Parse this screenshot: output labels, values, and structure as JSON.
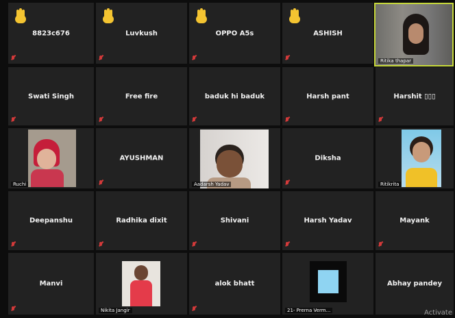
{
  "participants": [
    {
      "name": "8823c676",
      "hand": true
    },
    {
      "name": "Luvkush",
      "hand": true
    },
    {
      "name": "OPPO A5s",
      "hand": true
    },
    {
      "name": "ASHISH",
      "hand": true
    },
    {
      "name": "Ritika thapar",
      "video": true
    },
    {
      "name": "Swati Singh"
    },
    {
      "name": "Free fire"
    },
    {
      "name": "baduk hi baduk"
    },
    {
      "name": "Harsh pant"
    },
    {
      "name": "Harshit ▯▯▯"
    },
    {
      "name": "Ruchi",
      "video": true
    },
    {
      "name": "AYUSHMAN"
    },
    {
      "name": "Aadarsh Yadav",
      "video": true
    },
    {
      "name": "Diksha"
    },
    {
      "name": "Ritikrita",
      "video": true
    },
    {
      "name": "Deepanshu"
    },
    {
      "name": "Radhika dixit"
    },
    {
      "name": "Shivani"
    },
    {
      "name": "Harsh Yadav"
    },
    {
      "name": "Mayank"
    },
    {
      "name": "Manvi"
    },
    {
      "name": "Nikita Jangir",
      "video": true
    },
    {
      "name": "alok bhatt"
    },
    {
      "name": "21- Prerna Verm...",
      "video": true
    },
    {
      "name": "Abhay pandey"
    }
  ],
  "watermark": "Activate",
  "colors": {
    "tile": "#222222",
    "active_speaker_border": "#c7d93a",
    "muted_mic": "#d43a3a",
    "raised_hand": "#f4c431"
  }
}
